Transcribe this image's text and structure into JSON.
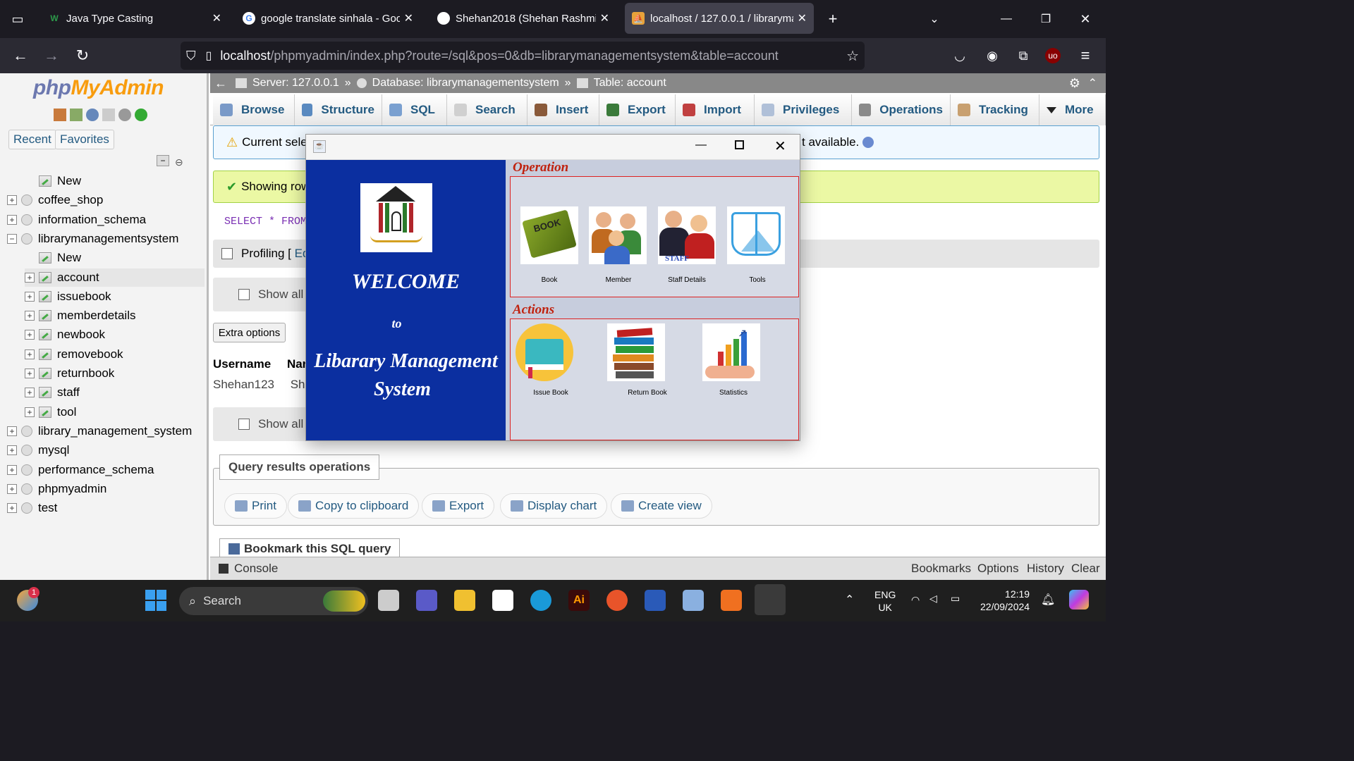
{
  "browser": {
    "tabs": [
      {
        "title": "Java Type Casting",
        "favicon": "W",
        "active": false
      },
      {
        "title": "google translate sinhala - Goog",
        "favicon": "G",
        "active": false
      },
      {
        "title": "Shehan2018 (Shehan Rashmika)",
        "favicon": "gh",
        "active": false
      },
      {
        "title": "localhost / 127.0.0.1 / libraryma",
        "favicon": "pma",
        "active": true
      }
    ],
    "url_host": "localhost",
    "url_path": "/phpmyadmin/index.php?route=/sql&pos=0&db=librarymanagementsystem&table=account"
  },
  "pma": {
    "logo_a": "php",
    "logo_b": "MyAdmin",
    "recent_label": "Recent",
    "favorites_label": "Favorites",
    "tree": [
      {
        "label": "New",
        "level": 1,
        "type": "new"
      },
      {
        "label": "coffee_shop",
        "level": 0,
        "type": "db"
      },
      {
        "label": "information_schema",
        "level": 0,
        "type": "db"
      },
      {
        "label": "librarymanagementsystem",
        "level": 0,
        "type": "db",
        "expanded": true
      },
      {
        "label": "New",
        "level": 1,
        "type": "new"
      },
      {
        "label": "account",
        "level": 1,
        "type": "table",
        "selected": true
      },
      {
        "label": "issuebook",
        "level": 1,
        "type": "table"
      },
      {
        "label": "memberdetails",
        "level": 1,
        "type": "table"
      },
      {
        "label": "newbook",
        "level": 1,
        "type": "table"
      },
      {
        "label": "removebook",
        "level": 1,
        "type": "table"
      },
      {
        "label": "returnbook",
        "level": 1,
        "type": "table"
      },
      {
        "label": "staff",
        "level": 1,
        "type": "table"
      },
      {
        "label": "tool",
        "level": 1,
        "type": "table"
      },
      {
        "label": "library_management_system",
        "level": 0,
        "type": "db"
      },
      {
        "label": "mysql",
        "level": 0,
        "type": "db"
      },
      {
        "label": "performance_schema",
        "level": 0,
        "type": "db"
      },
      {
        "label": "phpmyadmin",
        "level": 0,
        "type": "db"
      },
      {
        "label": "test",
        "level": 0,
        "type": "db"
      }
    ],
    "breadcrumb": {
      "server": "Server: 127.0.0.1",
      "database": "Database: librarymanagementsystem",
      "table": "Table: account",
      "sep": "»"
    },
    "tabs": [
      "Browse",
      "Structure",
      "SQL",
      "Search",
      "Insert",
      "Export",
      "Import",
      "Privileges",
      "Operations",
      "Tracking",
      "More"
    ],
    "warning_left": "Current sele",
    "warning_right": "t available.",
    "showing": "Showing row",
    "sql_text": "SELECT * FROM",
    "profiling": "Profiling [",
    "profiling_edit": "Ed",
    "show_all": "Show all",
    "extra_options": "Extra options",
    "col_username": "Username",
    "col_name": "Nar",
    "cell_username": "Shehan123",
    "cell_name": "She",
    "qro_title": "Query results operations",
    "qro_buttons": [
      "Print",
      "Copy to clipboard",
      "Export",
      "Display chart",
      "Create view"
    ],
    "bookmark": "Bookmark this SQL query",
    "console": "Console",
    "console_links": [
      "Bookmarks",
      "Options",
      "History",
      "Clear"
    ]
  },
  "app": {
    "welcome": "WELCOME",
    "to": "to",
    "title_line1": "Libarary Management",
    "title_line2": "System",
    "operation_title": "Operation",
    "actions_title": "Actions",
    "operation_items": [
      "Book",
      "Member",
      "Staff Details",
      "Tools"
    ],
    "action_items": [
      "Issue Book",
      "Return Book",
      "Statistics"
    ]
  },
  "taskbar": {
    "search": "Search",
    "lang1": "ENG",
    "lang2": "UK",
    "time": "12:19",
    "date": "22/09/2024",
    "badge": "1"
  }
}
